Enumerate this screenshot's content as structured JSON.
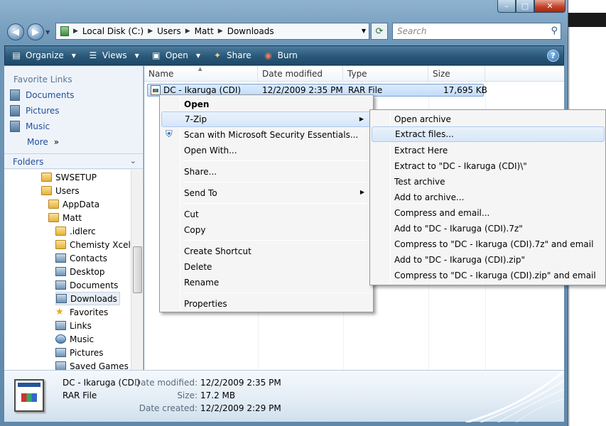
{
  "window": {
    "caption_buttons": [
      "–",
      "□",
      "✕"
    ]
  },
  "address_bar": {
    "crumbs": [
      "Local Disk (C:)",
      "Users",
      "Matt",
      "Downloads"
    ],
    "search_placeholder": "Search"
  },
  "toolbar": {
    "items": [
      {
        "label": "Organize",
        "icon": "organize-icon",
        "dropdown": true
      },
      {
        "label": "Views",
        "icon": "views-icon",
        "dropdown": true
      },
      {
        "label": "Open",
        "icon": "open-icon",
        "dropdown": true
      },
      {
        "label": "Share",
        "icon": "share-icon",
        "dropdown": false
      },
      {
        "label": "Burn",
        "icon": "burn-icon",
        "dropdown": false
      }
    ],
    "help": "?"
  },
  "nav_pane": {
    "favorite_links_header": "Favorite Links",
    "favorites": [
      "Documents",
      "Pictures",
      "Music"
    ],
    "more": "More",
    "folders_header": "Folders",
    "tree": [
      {
        "label": "SWSETUP",
        "icon": "folder"
      },
      {
        "label": "Users",
        "icon": "folder"
      },
      {
        "label": "AppData",
        "icon": "folder"
      },
      {
        "label": "Matt",
        "icon": "folder"
      },
      {
        "label": ".idlerc",
        "icon": "folder"
      },
      {
        "label": "Chemisty Xcel E",
        "icon": "folder"
      },
      {
        "label": "Contacts",
        "icon": "sys"
      },
      {
        "label": "Desktop",
        "icon": "sys"
      },
      {
        "label": "Documents",
        "icon": "sys"
      },
      {
        "label": "Downloads",
        "icon": "sys",
        "selected": true
      },
      {
        "label": "Favorites",
        "icon": "star"
      },
      {
        "label": "Links",
        "icon": "sys"
      },
      {
        "label": "Music",
        "icon": "music"
      },
      {
        "label": "Pictures",
        "icon": "sys"
      },
      {
        "label": "Saved Games",
        "icon": "sys"
      }
    ]
  },
  "file_list": {
    "columns": [
      "Name",
      "Date modified",
      "Type",
      "Size"
    ],
    "rows": [
      {
        "name": "DC - Ikaruga (CDI)",
        "date": "12/2/2009 2:35 PM",
        "type": "RAR File",
        "size": "17,695 KB"
      }
    ]
  },
  "context_menu": {
    "items": [
      {
        "label": "Open",
        "bold": true
      },
      {
        "label": "7-Zip",
        "submenu": true,
        "highlighted": true
      },
      {
        "label": "Scan with Microsoft Security Essentials...",
        "icon": "security-essentials-icon"
      },
      {
        "label": "Open With..."
      },
      {
        "label": "Share..."
      },
      {
        "label": "Send To",
        "submenu": true
      },
      {
        "label": "Cut"
      },
      {
        "label": "Copy"
      },
      {
        "label": "Create Shortcut"
      },
      {
        "label": "Delete"
      },
      {
        "label": "Rename"
      },
      {
        "label": "Properties"
      }
    ]
  },
  "submenu_7zip": {
    "items": [
      "Open archive",
      "Extract files...",
      "Extract Here",
      "Extract to \"DC - Ikaruga (CDI)\\\"",
      "Test archive",
      "Add to archive...",
      "Compress and email...",
      "Add to \"DC - Ikaruga (CDI).7z\"",
      "Compress to \"DC - Ikaruga (CDI).7z\" and email",
      "Add to \"DC - Ikaruga (CDI).zip\"",
      "Compress to \"DC - Ikaruga (CDI).zip\" and email"
    ],
    "highlighted_index": 1
  },
  "details_pane": {
    "name": "DC - Ikaruga (CDI)",
    "type": "RAR File",
    "date_modified_label": "Date modified:",
    "date_modified": "12/2/2009 2:35 PM",
    "size_label": "Size:",
    "size": "17.2 MB",
    "date_created_label": "Date created:",
    "date_created": "12/2/2009 2:29 PM"
  }
}
